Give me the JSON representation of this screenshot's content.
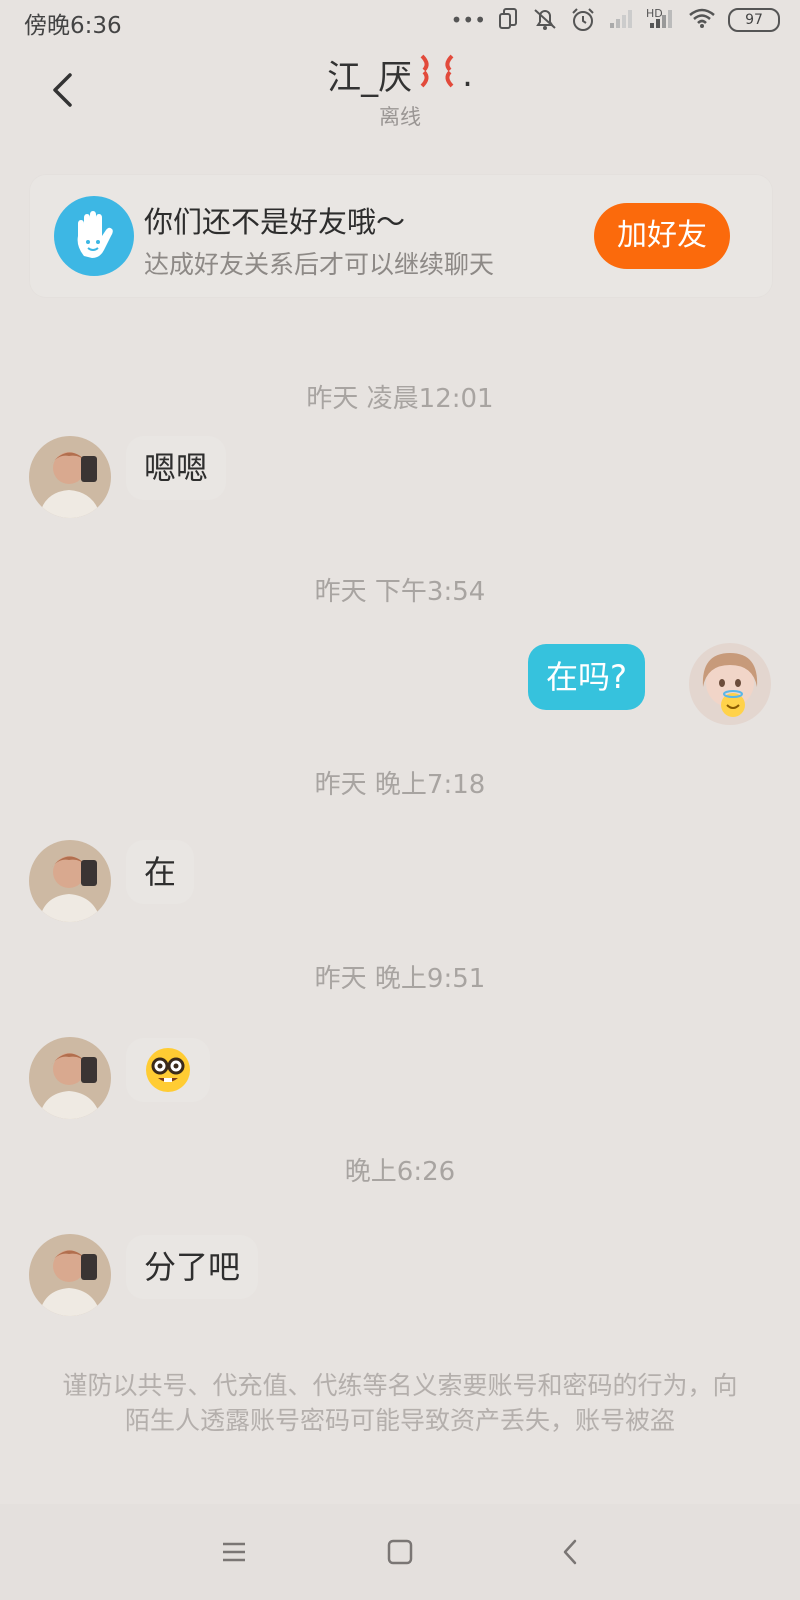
{
  "status_bar": {
    "time": "傍晚6:36",
    "hd_label": "HD",
    "battery": "97"
  },
  "header": {
    "title": "江_厌",
    "title_suffix": ".",
    "status": "离线"
  },
  "banner": {
    "title": "你们还不是好友哦～",
    "description": "达成好友关系后才可以继续聊天",
    "add_button": "加好友"
  },
  "messages": [
    {
      "timestamp": "昨天 凌晨12:01",
      "side": "left",
      "text": "嗯嗯"
    },
    {
      "timestamp": "昨天 下午3:54",
      "side": "right",
      "text": "在吗?"
    },
    {
      "timestamp": "昨天 晚上7:18",
      "side": "left",
      "text": "在"
    },
    {
      "timestamp": "昨天 晚上9:51",
      "side": "left",
      "emoji": "nerd-face"
    },
    {
      "timestamp": "晚上6:26",
      "side": "left",
      "text": "分了吧"
    }
  ],
  "notice": "谨防以共号、代充值、代练等名义索要账号和密码的行为，向陌生人透露账号密码可能导致资产丢失，账号被盗",
  "colors": {
    "background": "#e7e3e0",
    "accent_orange": "#fb6a0c",
    "bubble_blue": "#36c2dd",
    "banner_icon_blue": "#3db7e4"
  }
}
